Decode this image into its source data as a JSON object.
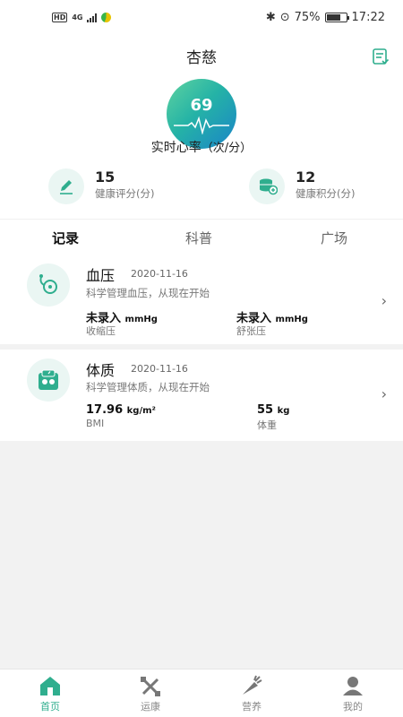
{
  "status_bar": {
    "hd": "HD",
    "network": "4G",
    "battery": "75%",
    "time": "17:22"
  },
  "header": {
    "title": "杏慈"
  },
  "heart_rate": {
    "value": "69",
    "label": "实时心率",
    "unit": "（次/分）"
  },
  "scores": [
    {
      "value": "15",
      "label": "健康评分(分)",
      "icon": "pencil-icon"
    },
    {
      "value": "12",
      "label": "健康积分(分)",
      "icon": "coins-icon"
    }
  ],
  "tabs": [
    {
      "label": "记录",
      "active": true
    },
    {
      "label": "科普",
      "active": false
    },
    {
      "label": "广场",
      "active": false
    }
  ],
  "records": [
    {
      "name": "血压",
      "date": "2020-11-16",
      "desc": "科学管理血压，从现在开始",
      "icon": "blood-pressure-icon",
      "metrics": [
        {
          "value": "未录入",
          "unit": "mmHg",
          "label": "收缩压"
        },
        {
          "value": "未录入",
          "unit": "mmHg",
          "label": "舒张压"
        }
      ]
    },
    {
      "name": "体质",
      "date": "2020-11-16",
      "desc": "科学管理体质，从现在开始",
      "icon": "scale-icon",
      "metrics": [
        {
          "value": "17.96",
          "unit": "kg/m²",
          "label": "BMI"
        },
        {
          "value": "55",
          "unit": "kg",
          "label": "体重"
        }
      ]
    }
  ],
  "bottom_nav": [
    {
      "label": "首页",
      "icon": "home-icon",
      "active": true
    },
    {
      "label": "运康",
      "icon": "dumbbell-icon",
      "active": false
    },
    {
      "label": "营养",
      "icon": "carrot-icon",
      "active": false
    },
    {
      "label": "我的",
      "icon": "person-icon",
      "active": false
    }
  ],
  "colors": {
    "accent": "#2fae8e",
    "icon_bg": "#eaf6f3"
  }
}
